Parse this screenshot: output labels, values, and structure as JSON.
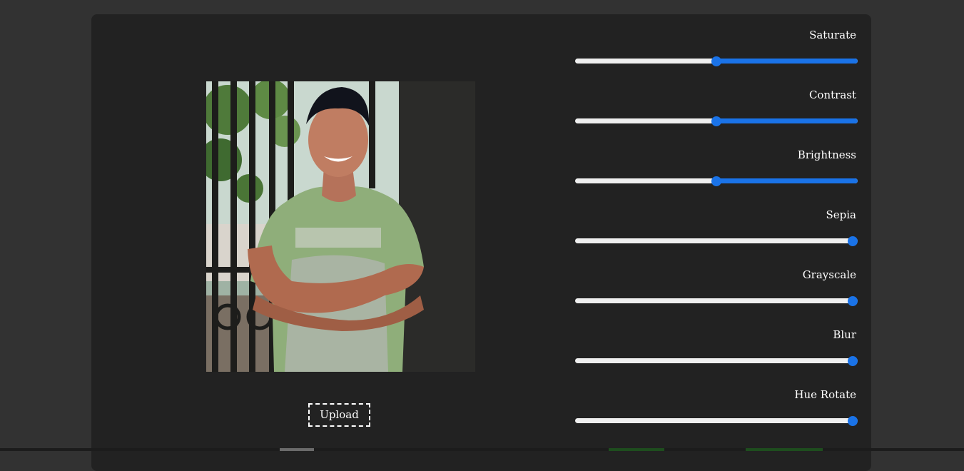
{
  "colors": {
    "page_background": "#323232",
    "panel_background": "#222222",
    "slider_accent": "#1a73e8",
    "slider_track": "#efefef",
    "text": "#ffffff"
  },
  "preview": {
    "image_description_icon": "photo-image",
    "upload_label": "Upload"
  },
  "filters": [
    {
      "key": "saturate",
      "label": "Saturate",
      "value": 0.5
    },
    {
      "key": "contrast",
      "label": "Contrast",
      "value": 0.5
    },
    {
      "key": "brightness",
      "label": "Brightness",
      "value": 0.5
    },
    {
      "key": "sepia",
      "label": "Sepia",
      "value": 1.0
    },
    {
      "key": "grayscale",
      "label": "Grayscale",
      "value": 1.0
    },
    {
      "key": "blur",
      "label": "Blur",
      "value": 1.0
    },
    {
      "key": "hue_rotate",
      "label": "Hue Rotate",
      "value": 1.0
    }
  ]
}
